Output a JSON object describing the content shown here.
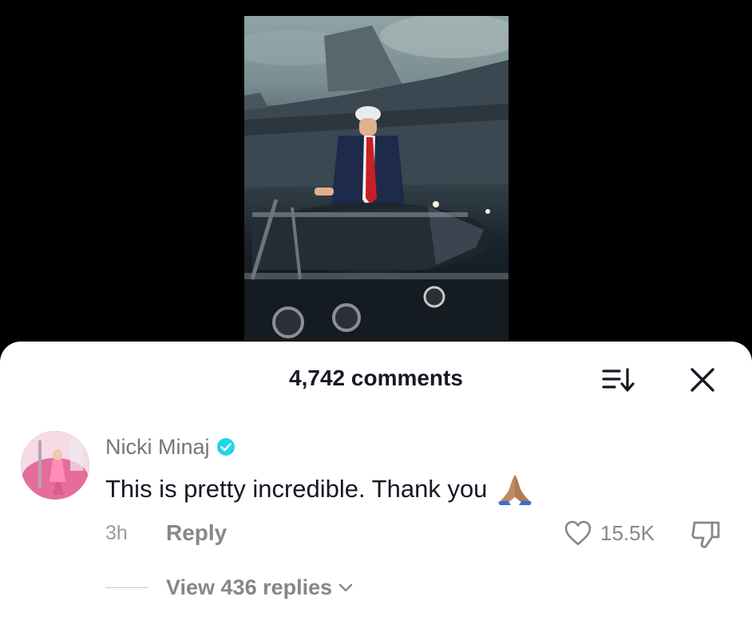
{
  "video": {
    "scene": "image"
  },
  "comments_sheet": {
    "count_label": "4,742 comments",
    "icons": {
      "sort": "sort-icon",
      "close": "close-icon"
    }
  },
  "comment": {
    "username": "Nicki Minaj",
    "verified": true,
    "text": "This is pretty incredible. Thank you",
    "emoji": "🙏🏽",
    "time": "3h",
    "reply_label": "Reply",
    "like_count": "15.5K",
    "replies_label": "View 436 replies",
    "colors": {
      "verified": "#20d5ec",
      "text": "#161823",
      "muted": "#86878c"
    }
  }
}
